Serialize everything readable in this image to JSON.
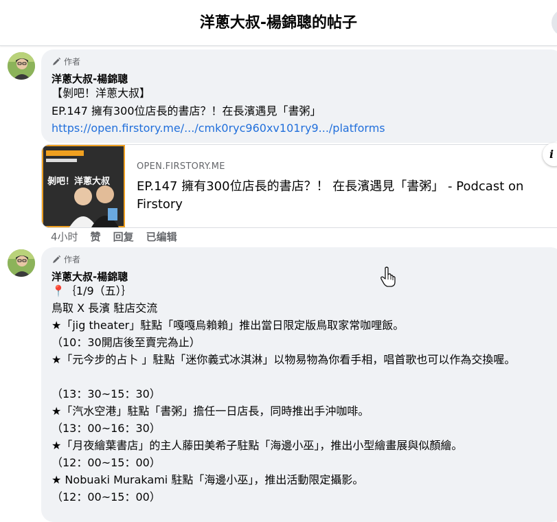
{
  "header": {
    "title": "洋蔥大叔-楊錦聰的帖子"
  },
  "posts": [
    {
      "badge": "作者",
      "author": "洋蔥大叔-楊錦聰",
      "lines": [
        "【剝吧！洋蔥大叔】",
        "EP.147 擁有300位店長的書店？！在長濱遇見「書粥」"
      ],
      "link": "https://open.firstory.me/.../cmk0ryc960xv101ry9.../platforms",
      "preview": {
        "domain": "OPEN.FIRSTORY.ME",
        "title": "EP.147 擁有300位店長的書店？！ 在長濱遇見「書粥」 - Podcast on Firstory",
        "thumb_text": "剝吧！洋蔥大叔"
      },
      "actions": {
        "time": "4小时",
        "like": "赞",
        "reply": "回复",
        "edited": "已编辑"
      }
    },
    {
      "badge": "作者",
      "author": "洋蔥大叔-楊錦聰",
      "lines": [
        "📍｛1/9（五）｝",
        "鳥取 X 長濱 駐店交流",
        "★「jig theater」駐點「嘎嘎烏賴賴」推出當日限定版鳥取家常咖哩飯。",
        "（10：30開店後至賣完為止）",
        "★「元今步的占卜 」駐點「迷你義式冰淇淋」以物易物為你看手相，唱首歌也可以作為交換喔。",
        "（13：30~15：30）",
        "★「汽水空港」駐點「書粥」擔任一日店長，同時推出手沖咖啡。",
        "（13：00~16：30）",
        "★「月夜繪葉書店」的主人藤田美希子駐點「海邊小巫」，推出小型繪畫展與似顏繪。",
        "（12：00~15：00）",
        "★ Nobuaki Murakami 駐點「海邊小巫」，推出活動限定攝影。",
        "（12：00~15：00）"
      ]
    }
  ],
  "colors": {
    "link": "#216fdb",
    "bubble": "#f0f2f5",
    "muted": "#65676b"
  }
}
